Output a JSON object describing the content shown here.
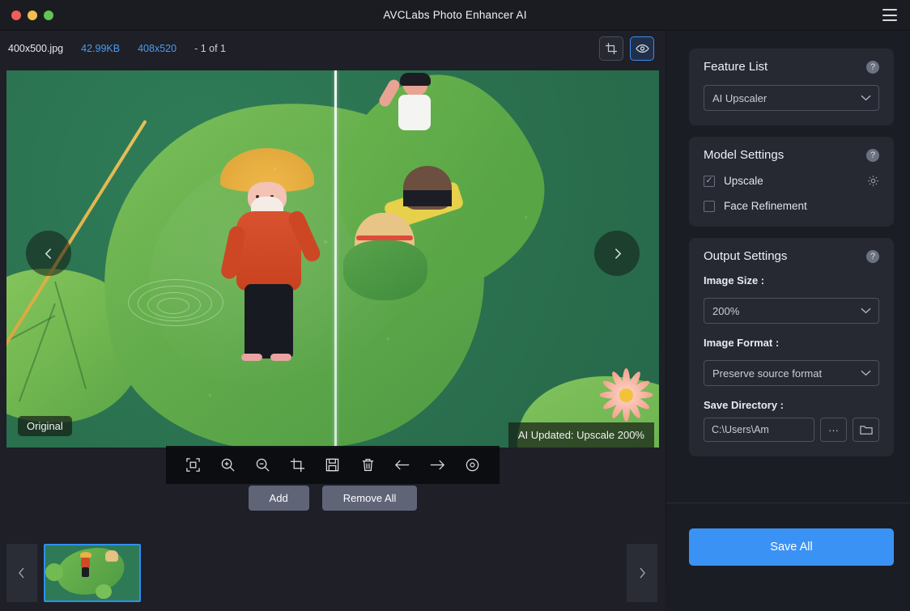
{
  "window": {
    "title": "AVCLabs Photo Enhancer AI",
    "menu_icon": "hamburger-icon",
    "traffic_lights": [
      "close",
      "minimize",
      "maximize"
    ]
  },
  "infobar": {
    "filename": "400x500.jpg",
    "filesize": "42.99KB",
    "dimensions": "408x520",
    "counter": "- 1 of 1",
    "crop_icon": "crop-icon",
    "preview_icon": "eye-icon"
  },
  "viewer": {
    "original_badge": "Original",
    "ai_badge": "AI Updated: Upscale 200%",
    "prev_icon": "chevron-left-icon",
    "next_icon": "chevron-right-icon",
    "toolbar": [
      {
        "name": "fit-to-screen-icon",
        "label": "Fit to screen"
      },
      {
        "name": "zoom-in-icon",
        "label": "Zoom in"
      },
      {
        "name": "zoom-out-icon",
        "label": "Zoom out"
      },
      {
        "name": "crop-icon",
        "label": "Crop"
      },
      {
        "name": "save-icon",
        "label": "Save"
      },
      {
        "name": "trash-icon",
        "label": "Delete"
      },
      {
        "name": "arrow-left-icon",
        "label": "Previous"
      },
      {
        "name": "arrow-right-icon",
        "label": "Next"
      },
      {
        "name": "compare-eye-icon",
        "label": "Compare"
      }
    ]
  },
  "actions": {
    "add_label": "Add",
    "remove_all_label": "Remove All"
  },
  "filmstrip": {
    "prev_icon": "chevron-left-icon",
    "next_icon": "chevron-right-icon",
    "selected_index": 0
  },
  "sidebar": {
    "feature_list": {
      "title": "Feature List",
      "help": "?",
      "selected": "AI Upscaler"
    },
    "model_settings": {
      "title": "Model Settings",
      "help": "?",
      "options": [
        {
          "label": "Upscale",
          "checked": true,
          "has_gear": true
        },
        {
          "label": "Face Refinement",
          "checked": false,
          "has_gear": false
        }
      ]
    },
    "output_settings": {
      "title": "Output Settings",
      "help": "?",
      "image_size_label": "Image Size :",
      "image_size_value": "200%",
      "image_format_label": "Image Format :",
      "image_format_value": "Preserve source format",
      "save_directory_label": "Save Directory :",
      "save_directory_value": "C:\\Users\\Am",
      "browse_dots_label": "···",
      "folder_icon": "folder-icon"
    },
    "save_all_label": "Save All"
  },
  "colors": {
    "accent_blue": "#3b92f5",
    "link_blue": "#4c9bf0",
    "panel_bg": "#262932",
    "window_bg": "#1b1d24",
    "button_grey": "#5f6477"
  }
}
